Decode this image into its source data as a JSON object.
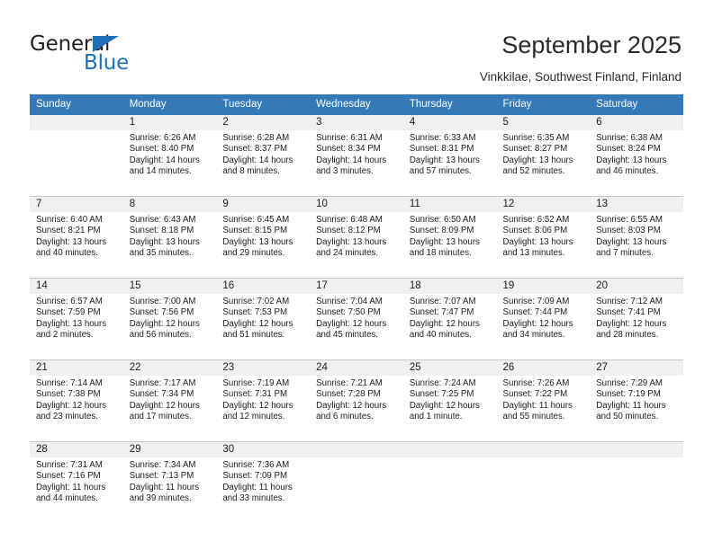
{
  "brand": {
    "name_top": "General",
    "name_bottom": "Blue",
    "color_blue": "#1e6fb8",
    "color_dark": "#231f20"
  },
  "header": {
    "title": "September 2025",
    "subtitle": "Vinkkilae, Southwest Finland, Finland"
  },
  "calendar": {
    "header_bg": "#3479b8",
    "daynum_bg": "#f0f0f0",
    "weekdays": [
      "Sunday",
      "Monday",
      "Tuesday",
      "Wednesday",
      "Thursday",
      "Friday",
      "Saturday"
    ],
    "labels": {
      "sunrise": "Sunrise:",
      "sunset": "Sunset:",
      "daylight": "Daylight:"
    },
    "weeks": [
      [
        {
          "day": "",
          "blank": true
        },
        {
          "day": "1",
          "sunrise": "Sunrise: 6:26 AM",
          "sunset": "Sunset: 8:40 PM",
          "daylight": "Daylight: 14 hours and 14 minutes."
        },
        {
          "day": "2",
          "sunrise": "Sunrise: 6:28 AM",
          "sunset": "Sunset: 8:37 PM",
          "daylight": "Daylight: 14 hours and 8 minutes."
        },
        {
          "day": "3",
          "sunrise": "Sunrise: 6:31 AM",
          "sunset": "Sunset: 8:34 PM",
          "daylight": "Daylight: 14 hours and 3 minutes."
        },
        {
          "day": "4",
          "sunrise": "Sunrise: 6:33 AM",
          "sunset": "Sunset: 8:31 PM",
          "daylight": "Daylight: 13 hours and 57 minutes."
        },
        {
          "day": "5",
          "sunrise": "Sunrise: 6:35 AM",
          "sunset": "Sunset: 8:27 PM",
          "daylight": "Daylight: 13 hours and 52 minutes."
        },
        {
          "day": "6",
          "sunrise": "Sunrise: 6:38 AM",
          "sunset": "Sunset: 8:24 PM",
          "daylight": "Daylight: 13 hours and 46 minutes."
        }
      ],
      [
        {
          "day": "7",
          "sunrise": "Sunrise: 6:40 AM",
          "sunset": "Sunset: 8:21 PM",
          "daylight": "Daylight: 13 hours and 40 minutes."
        },
        {
          "day": "8",
          "sunrise": "Sunrise: 6:43 AM",
          "sunset": "Sunset: 8:18 PM",
          "daylight": "Daylight: 13 hours and 35 minutes."
        },
        {
          "day": "9",
          "sunrise": "Sunrise: 6:45 AM",
          "sunset": "Sunset: 8:15 PM",
          "daylight": "Daylight: 13 hours and 29 minutes."
        },
        {
          "day": "10",
          "sunrise": "Sunrise: 6:48 AM",
          "sunset": "Sunset: 8:12 PM",
          "daylight": "Daylight: 13 hours and 24 minutes."
        },
        {
          "day": "11",
          "sunrise": "Sunrise: 6:50 AM",
          "sunset": "Sunset: 8:09 PM",
          "daylight": "Daylight: 13 hours and 18 minutes."
        },
        {
          "day": "12",
          "sunrise": "Sunrise: 6:52 AM",
          "sunset": "Sunset: 8:06 PM",
          "daylight": "Daylight: 13 hours and 13 minutes."
        },
        {
          "day": "13",
          "sunrise": "Sunrise: 6:55 AM",
          "sunset": "Sunset: 8:03 PM",
          "daylight": "Daylight: 13 hours and 7 minutes."
        }
      ],
      [
        {
          "day": "14",
          "sunrise": "Sunrise: 6:57 AM",
          "sunset": "Sunset: 7:59 PM",
          "daylight": "Daylight: 13 hours and 2 minutes."
        },
        {
          "day": "15",
          "sunrise": "Sunrise: 7:00 AM",
          "sunset": "Sunset: 7:56 PM",
          "daylight": "Daylight: 12 hours and 56 minutes."
        },
        {
          "day": "16",
          "sunrise": "Sunrise: 7:02 AM",
          "sunset": "Sunset: 7:53 PM",
          "daylight": "Daylight: 12 hours and 51 minutes."
        },
        {
          "day": "17",
          "sunrise": "Sunrise: 7:04 AM",
          "sunset": "Sunset: 7:50 PM",
          "daylight": "Daylight: 12 hours and 45 minutes."
        },
        {
          "day": "18",
          "sunrise": "Sunrise: 7:07 AM",
          "sunset": "Sunset: 7:47 PM",
          "daylight": "Daylight: 12 hours and 40 minutes."
        },
        {
          "day": "19",
          "sunrise": "Sunrise: 7:09 AM",
          "sunset": "Sunset: 7:44 PM",
          "daylight": "Daylight: 12 hours and 34 minutes."
        },
        {
          "day": "20",
          "sunrise": "Sunrise: 7:12 AM",
          "sunset": "Sunset: 7:41 PM",
          "daylight": "Daylight: 12 hours and 28 minutes."
        }
      ],
      [
        {
          "day": "21",
          "sunrise": "Sunrise: 7:14 AM",
          "sunset": "Sunset: 7:38 PM",
          "daylight": "Daylight: 12 hours and 23 minutes."
        },
        {
          "day": "22",
          "sunrise": "Sunrise: 7:17 AM",
          "sunset": "Sunset: 7:34 PM",
          "daylight": "Daylight: 12 hours and 17 minutes."
        },
        {
          "day": "23",
          "sunrise": "Sunrise: 7:19 AM",
          "sunset": "Sunset: 7:31 PM",
          "daylight": "Daylight: 12 hours and 12 minutes."
        },
        {
          "day": "24",
          "sunrise": "Sunrise: 7:21 AM",
          "sunset": "Sunset: 7:28 PM",
          "daylight": "Daylight: 12 hours and 6 minutes."
        },
        {
          "day": "25",
          "sunrise": "Sunrise: 7:24 AM",
          "sunset": "Sunset: 7:25 PM",
          "daylight": "Daylight: 12 hours and 1 minute."
        },
        {
          "day": "26",
          "sunrise": "Sunrise: 7:26 AM",
          "sunset": "Sunset: 7:22 PM",
          "daylight": "Daylight: 11 hours and 55 minutes."
        },
        {
          "day": "27",
          "sunrise": "Sunrise: 7:29 AM",
          "sunset": "Sunset: 7:19 PM",
          "daylight": "Daylight: 11 hours and 50 minutes."
        }
      ],
      [
        {
          "day": "28",
          "sunrise": "Sunrise: 7:31 AM",
          "sunset": "Sunset: 7:16 PM",
          "daylight": "Daylight: 11 hours and 44 minutes."
        },
        {
          "day": "29",
          "sunrise": "Sunrise: 7:34 AM",
          "sunset": "Sunset: 7:13 PM",
          "daylight": "Daylight: 11 hours and 39 minutes."
        },
        {
          "day": "30",
          "sunrise": "Sunrise: 7:36 AM",
          "sunset": "Sunset: 7:09 PM",
          "daylight": "Daylight: 11 hours and 33 minutes."
        },
        {
          "day": "",
          "blank": true
        },
        {
          "day": "",
          "blank": true
        },
        {
          "day": "",
          "blank": true
        },
        {
          "day": "",
          "blank": true
        }
      ]
    ]
  }
}
